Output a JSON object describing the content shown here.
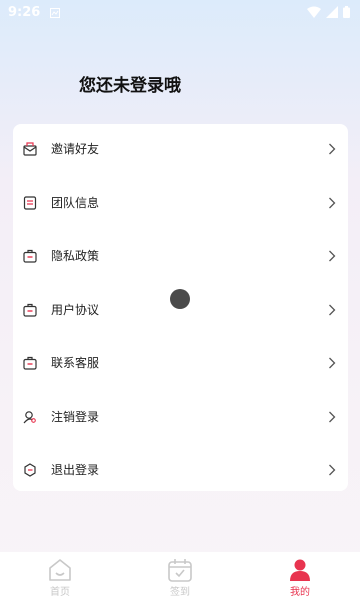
{
  "status_bar": {
    "time": "9:26"
  },
  "page": {
    "title": "您还未登录哦"
  },
  "menu": {
    "items": [
      {
        "label": "邀请好友",
        "icon": "mail-icon"
      },
      {
        "label": "团队信息",
        "icon": "document-icon"
      },
      {
        "label": "隐私政策",
        "icon": "briefcase-icon"
      },
      {
        "label": "用户协议",
        "icon": "briefcase-icon"
      },
      {
        "label": "联系客服",
        "icon": "briefcase-icon"
      },
      {
        "label": "注销登录",
        "icon": "user-search-icon"
      },
      {
        "label": "退出登录",
        "icon": "logout-icon"
      }
    ]
  },
  "tab_bar": {
    "tabs": [
      {
        "label": "首页",
        "icon": "home-icon",
        "active": false
      },
      {
        "label": "签到",
        "icon": "calendar-check-icon",
        "active": false
      },
      {
        "label": "我的",
        "icon": "profile-icon",
        "active": true
      }
    ]
  },
  "colors": {
    "accent": "#e8344f",
    "inactive": "#c8c8c8",
    "icon_stroke": "#333333"
  }
}
